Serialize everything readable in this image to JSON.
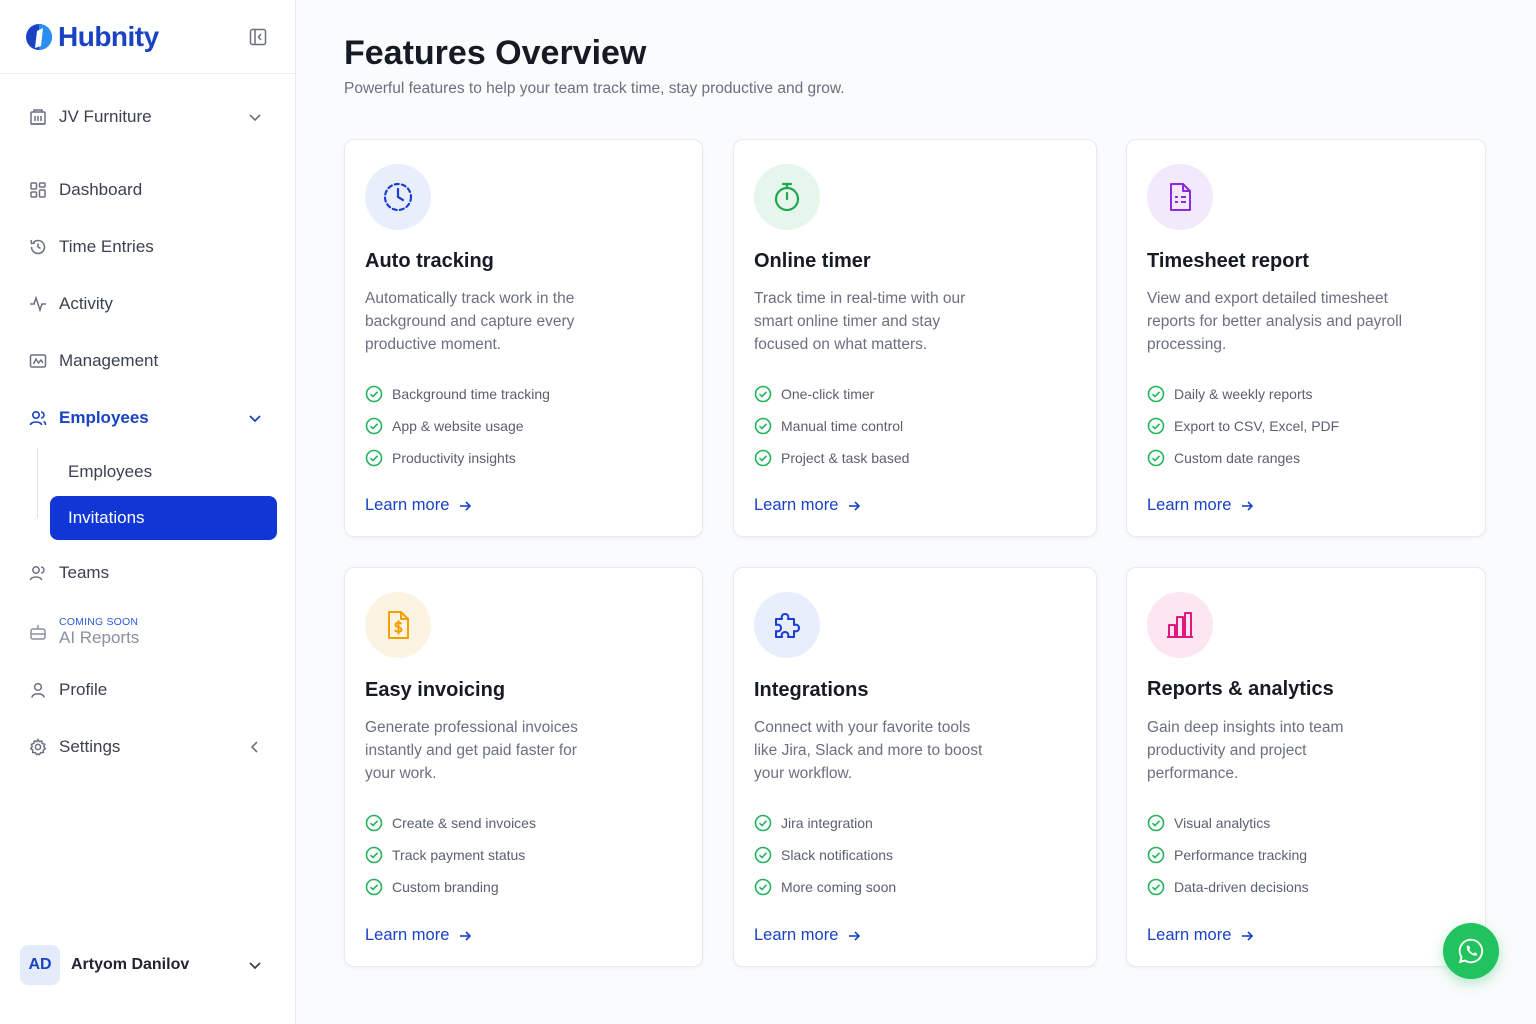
{
  "brand": {
    "name": "Hubnity"
  },
  "workspace": {
    "name": "JV Furniture"
  },
  "nav": {
    "dashboard": "Dashboard",
    "time_entries": "Time Entries",
    "activity": "Activity",
    "management": "Management",
    "employees": "Employees",
    "employees_sub": [
      "Employees",
      "Invitations"
    ],
    "teams": "Teams",
    "ai_reports_badge": "COMING SOON",
    "ai_reports": "AI Reports",
    "profile": "Profile",
    "settings": "Settings"
  },
  "user": {
    "initials": "AD",
    "name": "Artyom Danilov"
  },
  "page": {
    "title": "Features Overview",
    "subtitle": "Powerful features to help your team track time, stay productive and grow."
  },
  "cards": [
    {
      "title": "Auto tracking",
      "description": "Automatically track work in the background and capture every productive moment.",
      "features": [
        "Background time tracking",
        "App & website usage",
        "Productivity insights"
      ],
      "link": "Learn more",
      "icon": "clock-icon",
      "icon_color": "#1a3fd0",
      "icon_bg": "#e9eefc"
    },
    {
      "title": "Online timer",
      "description": "Track time in real-time with our smart online timer and stay focused on what matters.",
      "features": [
        "One-click timer",
        "Manual time control",
        "Project & task based"
      ],
      "link": "Learn more",
      "icon": "stopwatch-icon",
      "icon_color": "#1ea84c",
      "icon_bg": "#e6f6ec"
    },
    {
      "title": "Timesheet report",
      "description": "View and export detailed timesheet reports for better analysis and payroll processing.",
      "features": [
        "Daily & weekly reports",
        "Export to CSV, Excel, PDF",
        "Custom date ranges"
      ],
      "link": "Learn more",
      "icon": "document-icon",
      "icon_color": "#8a2be2",
      "icon_bg": "#f2e9fc"
    },
    {
      "title": "Easy invoicing",
      "description": "Generate professional invoices instantly and get paid faster for your work.",
      "features": [
        "Create & send invoices",
        "Track payment status",
        "Custom branding"
      ],
      "link": "Learn more",
      "icon": "invoice-icon",
      "icon_color": "#f2a100",
      "icon_bg": "#fdf3e2"
    },
    {
      "title": "Integrations",
      "description": "Connect with your favorite tools like Jira, Slack and more to boost your workflow.",
      "features": [
        "Jira integration",
        "Slack notifications",
        "More coming soon"
      ],
      "link": "Learn more",
      "icon": "puzzle-icon",
      "icon_color": "#1a3fd0",
      "icon_bg": "#e9eefc"
    },
    {
      "title": "Reports & analytics",
      "description": "Gain deep insights into team productivity and project performance.",
      "features": [
        "Visual analytics",
        "Performance tracking",
        "Data-driven decisions"
      ],
      "link": "Learn more",
      "icon": "bar-chart-icon",
      "icon_color": "#e0197d",
      "icon_bg": "#fce6f1"
    }
  ],
  "colors": {
    "accent": "#1036d6",
    "check": "#22b35a",
    "whatsapp": "#22c35e"
  }
}
